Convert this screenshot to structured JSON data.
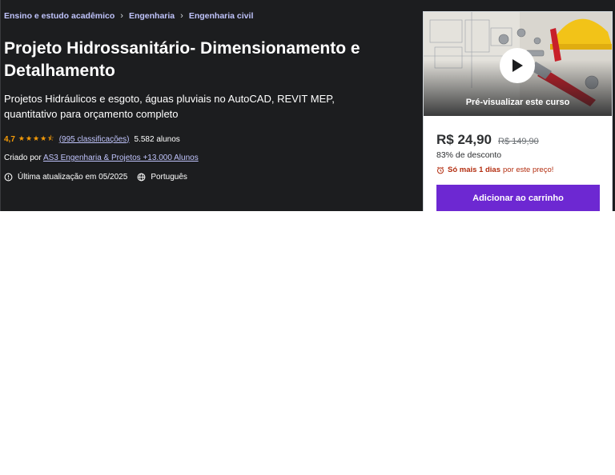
{
  "breadcrumb": [
    "Ensino e estudo acadêmico",
    "Engenharia",
    "Engenharia civil"
  ],
  "course": {
    "title": "Projeto Hidrossanitário- Dimensionamento e Detalhamento",
    "subtitle": "Projetos Hidráulicos e esgoto, águas pluviais no AutoCAD, REVIT MEP, quantitativo para orçamento completo",
    "rating": "4,7",
    "stars": "★★★★⯪",
    "ratings_count": "(995 classificações)",
    "students": "5.582 alunos",
    "created_by_label": "Criado por",
    "instructor": "AS3 Engenharia & Projetos +13.000 Alunos",
    "last_updated": "Última atualização em 05/2025",
    "language": "Português"
  },
  "card": {
    "preview_label": "Pré-visualizar este curso",
    "price": "R$ 24,90",
    "old_price": "R$ 149,90",
    "discount": "83% de desconto",
    "urgency_strong": "Só mais 1 dias",
    "urgency_rest": "por este preço!",
    "cart_button": "Adicionar ao carrinho"
  },
  "colors": {
    "banner_bg": "#1c1d1f",
    "link": "#c0c4fc",
    "star": "#f69c08",
    "accent": "#6d28d2",
    "urgency": "#b32d0f"
  }
}
